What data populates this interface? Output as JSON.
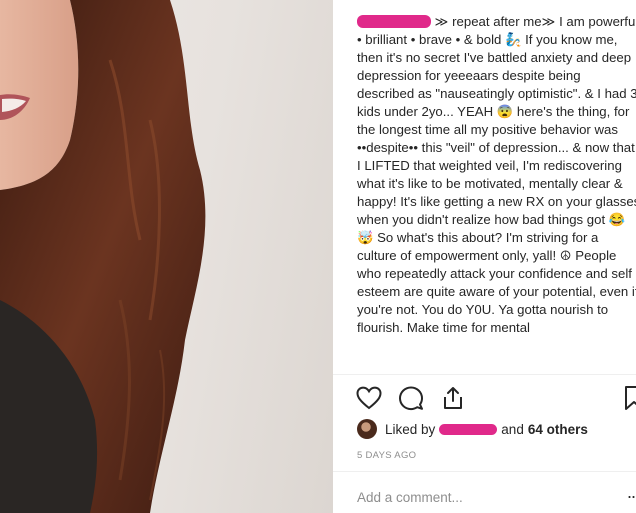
{
  "post": {
    "caption": {
      "arrows_open": "≫",
      "text_part1": "repeat after me",
      "arrows_close": "≫",
      "text_part2": "I am powerful • brilliant • brave • & bold",
      "emoji_1": "🧞",
      "text_part3": "If you know me, then it's no secret I've battled anxiety and deep depression for yeeeaars despite being described as \"nauseatingly optimistic\". & I had 3 kids under 2yo... YEAH",
      "emoji_2": "😨",
      "text_part4": "here's the thing, for the longest time all my positive behavior was ••despite•• this \"veil\" of depression... & now that I LIFTED that weighted veil, I'm rediscovering what it's like to be motivated, mentally clear & happy! It's like getting a new RX on your glasses when you didn't realize how bad things got",
      "emoji_3": "😂🤯",
      "text_part5": "So what's this about? I'm striving for a culture of empowerment only, yall!",
      "emoji_4": "☮",
      "text_part6": "People who repeatedly attack your confidence and self esteem are quite aware of your potential, even if you're not. You do Y0U. Ya gotta nourish to flourish. Make time for mental"
    },
    "likes": {
      "prefix": "Liked by",
      "joiner": "and",
      "others": "64 others"
    },
    "timestamp": "5 DAYS AGO",
    "comment_placeholder": "Add a comment...",
    "more": "..."
  },
  "icons": [
    "heart-icon",
    "comment-icon",
    "share-icon",
    "bookmark-icon"
  ],
  "colors": {
    "redaction": "#e0298a",
    "muted": "#8e8e8e",
    "text": "#262626"
  }
}
